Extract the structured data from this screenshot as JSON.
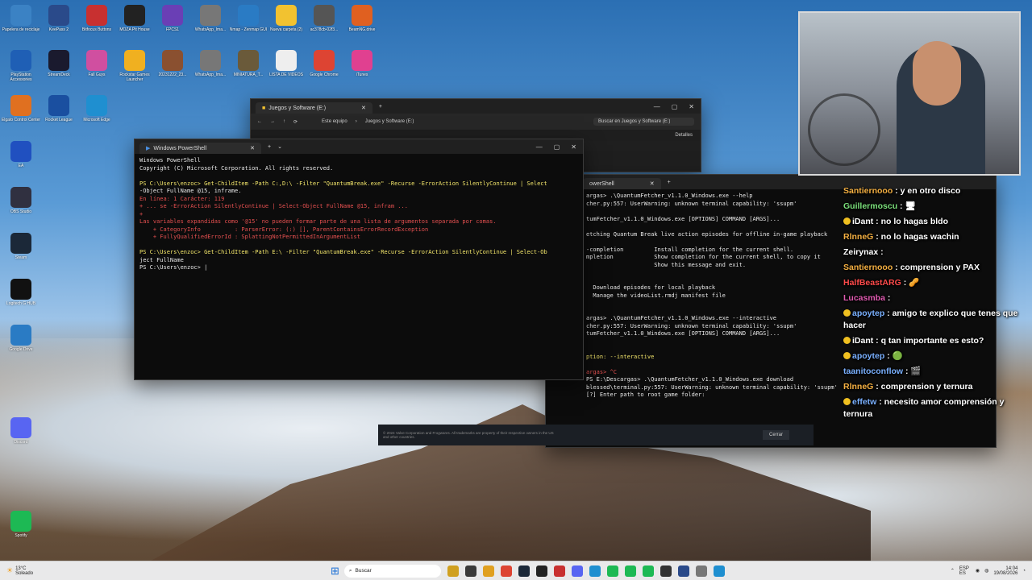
{
  "desktop_icons": [
    {
      "label": "Papelera de reciclaje",
      "color": "#3b82c4"
    },
    {
      "label": "KeePass 2",
      "color": "#2a4a8a"
    },
    {
      "label": "Bitfocus Buttons",
      "color": "#c83030"
    },
    {
      "label": "MOZA Pit House",
      "color": "#222222"
    },
    {
      "label": "FPCS1",
      "color": "#6a3fb5"
    },
    {
      "label": "WhatsApp_Ima...",
      "color": "#777777"
    },
    {
      "label": "Nmap - Zenmap GUI",
      "color": "#2a7bc4"
    },
    {
      "label": "Nueva carpeta (2)",
      "color": "#f2c230"
    },
    {
      "label": "ac378cb-02f3...",
      "color": "#555555"
    },
    {
      "label": "BeamNG.drive",
      "color": "#e06020"
    },
    {
      "label": "PlayStation Accessories",
      "color": "#1f5fb5"
    },
    {
      "label": "StreamDeck",
      "color": "#1a1a2e"
    },
    {
      "label": "Fall Guys",
      "color": "#d04fa0"
    },
    {
      "label": "Rockstar Games Launcher",
      "color": "#f0b020"
    },
    {
      "label": "20231222_23...",
      "color": "#8a5030"
    },
    {
      "label": "WhatsApp_Ima...",
      "color": "#777777"
    },
    {
      "label": "MINIATURA_T...",
      "color": "#6a5a3a"
    },
    {
      "label": "LISTA DE VIDEOS",
      "color": "#eeeeee"
    },
    {
      "label": "Google Chrome",
      "color": "#dd4433"
    },
    {
      "label": "iTunes",
      "color": "#e04090"
    },
    {
      "label": "Elgato Control Center",
      "color": "#e07020"
    },
    {
      "label": "EA",
      "color": "#2050c0"
    },
    {
      "label": "OBS Studio",
      "color": "#303040"
    },
    {
      "label": "Steam",
      "color": "#1b2838"
    },
    {
      "label": "Logitech G HUB",
      "color": "#111111"
    },
    {
      "label": "Google Drive",
      "color": "#2a7bc4"
    },
    {
      "label": "Rocket League",
      "color": "#1a4fa0"
    },
    {
      "label": "Microsoft Edge",
      "color": "#1f8fd0"
    },
    {
      "label": "Discord",
      "color": "#5865f2"
    },
    {
      "label": "Spotify",
      "color": "#1db954"
    }
  ],
  "explorer": {
    "tab_title": "Juegos y Software (E:)",
    "breadcrumb": [
      "Este equipo",
      "Juegos y Software (E:)"
    ],
    "search_placeholder": "Buscar en Juegos y Software (E:)",
    "details_label": "Detalles"
  },
  "powershell": {
    "tab_title": "Windows PowerShell",
    "lines": [
      {
        "text": "Windows PowerShell",
        "cls": "c-white"
      },
      {
        "text": "Copyright (C) Microsoft Corporation. All rights reserved.",
        "cls": "c-white"
      },
      {
        "text": "",
        "cls": "c-white"
      },
      {
        "text": "PS C:\\Users\\enzoc> Get-ChildItem -Path C:,D:\\ -Filter \"QuantumBreak.exe\" -Recurse -ErrorAction SilentlyContinue | Select",
        "cls": "c-yellow"
      },
      {
        "text": "-Object FullName @15, inframe.",
        "cls": "c-white"
      },
      {
        "text": "En línea: 1 Carácter: 119",
        "cls": "c-red"
      },
      {
        "text": "+ ... se -ErrorAction SilentlyContinue | Select-Object FullName @15, infram ...",
        "cls": "c-red"
      },
      {
        "text": "+",
        "cls": "c-red"
      },
      {
        "text": "Las variables expandidas como '@15' no pueden formar parte de una lista de argumentos separada por comas.",
        "cls": "c-red"
      },
      {
        "text": "    + CategoryInfo          : ParserError: (:) [], ParentContainsErrorRecordException",
        "cls": "c-red"
      },
      {
        "text": "    + FullyQualifiedErrorId : SplattingNotPermittedInArgumentList",
        "cls": "c-red"
      },
      {
        "text": "",
        "cls": "c-white"
      },
      {
        "text": "PS C:\\Users\\enzoc> Get-ChildItem -Path E:\\ -Filter \"QuantumBreak.exe\" -Recurse -ErrorAction SilentlyContinue | Select-Ob",
        "cls": "c-yellow"
      },
      {
        "text": "ject FullName",
        "cls": "c-white"
      },
      {
        "text": "PS C:\\Users\\enzoc> |",
        "cls": "c-white"
      }
    ]
  },
  "terminal2": {
    "tab_title": "owerShell",
    "lines": [
      {
        "text": "argas> .\\QuantumFetcher_v1.1.0_Windows.exe --help",
        "cls": "c-white"
      },
      {
        "text": "cher.py:557: UserWarning: unknown terminal capability: 'ssupm'",
        "cls": "c-white"
      },
      {
        "text": "",
        "cls": "c-white"
      },
      {
        "text": "tumFetcher_v1.1.0_Windows.exe [OPTIONS] COMMAND [ARGS]...",
        "cls": "c-white"
      },
      {
        "text": "",
        "cls": "c-white"
      },
      {
        "text": "etching Quantum Break live action episodes for offline in-game playback",
        "cls": "c-white"
      },
      {
        "text": "",
        "cls": "c-white"
      },
      {
        "text": "-completion         Install completion for the current shell.",
        "cls": "c-white"
      },
      {
        "text": "mpletion            Show completion for the current shell, to copy it",
        "cls": "c-white"
      },
      {
        "text": "                    Show this message and exit.",
        "cls": "c-white"
      },
      {
        "text": "",
        "cls": "c-white"
      },
      {
        "text": "",
        "cls": "c-white"
      },
      {
        "text": "  Download episodes for local playback",
        "cls": "c-white"
      },
      {
        "text": "  Manage the videoList.rmdj manifest file",
        "cls": "c-white"
      },
      {
        "text": "",
        "cls": "c-white"
      },
      {
        "text": "",
        "cls": "c-white"
      },
      {
        "text": "argas> .\\QuantumFetcher_v1.1.0_Windows.exe --interactive",
        "cls": "c-white"
      },
      {
        "text": "cher.py:557: UserWarning: unknown terminal capability: 'ssupm'",
        "cls": "c-white"
      },
      {
        "text": "tumFetcher_v1.1.0_Windows.exe [OPTIONS] COMMAND [ARGS]...",
        "cls": "c-white"
      },
      {
        "text": "",
        "cls": "c-white"
      },
      {
        "text": "",
        "cls": "c-white"
      },
      {
        "text": "ption: --interactive",
        "cls": "c-yellow"
      },
      {
        "text": "",
        "cls": "c-white"
      },
      {
        "text": "argas> ^C",
        "cls": "c-red"
      },
      {
        "text": "PS E:\\Descargas> .\\QuantumFetcher_v1.1.0_Windows.exe download",
        "cls": "c-white"
      },
      {
        "text": "blessed\\terminal.py:557: UserWarning: unknown terminal capability: 'ssupm'",
        "cls": "c-white"
      },
      {
        "text": "[?] Enter path to root game folder:",
        "cls": "c-white"
      }
    ]
  },
  "steam_footer": {
    "legal": "© 2024 Valve Corporation and Frogwares. All trademarks are property of their respective owners in the US and other countries.",
    "close_label": "Cerrar"
  },
  "chat": [
    {
      "user": "Santiernooo",
      "color": "#f5b042",
      "text": "y en otro disco",
      "badge": false
    },
    {
      "user": "Guillermoscu",
      "color": "#7be07b",
      "text": "🖥",
      "badge": false
    },
    {
      "user": "iDant",
      "color": "#ffffff",
      "text": "no lo hagas bldo",
      "badge": true
    },
    {
      "user": "RlnneG",
      "color": "#f5b042",
      "text": "no lo hagas wachin",
      "badge": false
    },
    {
      "user": "Zeirynax",
      "color": "#ffffff",
      "text": "",
      "badge": false
    },
    {
      "user": "Santiernooo",
      "color": "#f5b042",
      "text": "comprension y PAX",
      "badge": false
    },
    {
      "user": "HalfBeastARG",
      "color": "#ff4a4a",
      "text": "🥜",
      "badge": false
    },
    {
      "user": "Lucasmba",
      "color": "#e05ab0",
      "text": "",
      "badge": false
    },
    {
      "user": "apoytep",
      "color": "#7ab0ff",
      "text": "amigo te explico que tenes que hacer",
      "badge": true
    },
    {
      "user": "iDant",
      "color": "#ffffff",
      "text": "q tan importante es esto?",
      "badge": true
    },
    {
      "user": "apoytep",
      "color": "#7ab0ff",
      "text": "🟢",
      "badge": true
    },
    {
      "user": "taanitoconflow",
      "color": "#7ab0ff",
      "text": "🎬",
      "badge": false
    },
    {
      "user": "RlnneG",
      "color": "#f5b042",
      "text": "comprension y ternura",
      "badge": false
    },
    {
      "user": "effetw",
      "color": "#7ab0ff",
      "text": "necesito amor comprensión y ternura",
      "badge": true
    }
  ],
  "taskbar": {
    "weather_temp": "13°C",
    "weather_desc": "Soleado",
    "search_label": "Buscar",
    "lang": "ESP ES",
    "time": "14:04",
    "date": "19/08/2026"
  }
}
